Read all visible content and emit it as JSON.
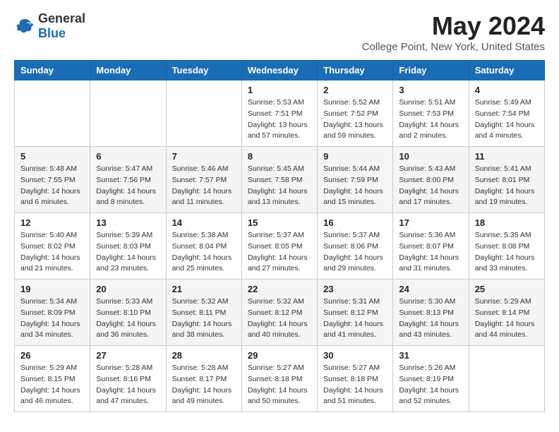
{
  "logo": {
    "general": "General",
    "blue": "Blue"
  },
  "header": {
    "month": "May 2024",
    "location": "College Point, New York, United States"
  },
  "weekdays": [
    "Sunday",
    "Monday",
    "Tuesday",
    "Wednesday",
    "Thursday",
    "Friday",
    "Saturday"
  ],
  "weeks": [
    [
      {
        "day": "",
        "info": ""
      },
      {
        "day": "",
        "info": ""
      },
      {
        "day": "",
        "info": ""
      },
      {
        "day": "1",
        "info": "Sunrise: 5:53 AM\nSunset: 7:51 PM\nDaylight: 13 hours\nand 57 minutes."
      },
      {
        "day": "2",
        "info": "Sunrise: 5:52 AM\nSunset: 7:52 PM\nDaylight: 13 hours\nand 59 minutes."
      },
      {
        "day": "3",
        "info": "Sunrise: 5:51 AM\nSunset: 7:53 PM\nDaylight: 14 hours\nand 2 minutes."
      },
      {
        "day": "4",
        "info": "Sunrise: 5:49 AM\nSunset: 7:54 PM\nDaylight: 14 hours\nand 4 minutes."
      }
    ],
    [
      {
        "day": "5",
        "info": "Sunrise: 5:48 AM\nSunset: 7:55 PM\nDaylight: 14 hours\nand 6 minutes."
      },
      {
        "day": "6",
        "info": "Sunrise: 5:47 AM\nSunset: 7:56 PM\nDaylight: 14 hours\nand 8 minutes."
      },
      {
        "day": "7",
        "info": "Sunrise: 5:46 AM\nSunset: 7:57 PM\nDaylight: 14 hours\nand 11 minutes."
      },
      {
        "day": "8",
        "info": "Sunrise: 5:45 AM\nSunset: 7:58 PM\nDaylight: 14 hours\nand 13 minutes."
      },
      {
        "day": "9",
        "info": "Sunrise: 5:44 AM\nSunset: 7:59 PM\nDaylight: 14 hours\nand 15 minutes."
      },
      {
        "day": "10",
        "info": "Sunrise: 5:43 AM\nSunset: 8:00 PM\nDaylight: 14 hours\nand 17 minutes."
      },
      {
        "day": "11",
        "info": "Sunrise: 5:41 AM\nSunset: 8:01 PM\nDaylight: 14 hours\nand 19 minutes."
      }
    ],
    [
      {
        "day": "12",
        "info": "Sunrise: 5:40 AM\nSunset: 8:02 PM\nDaylight: 14 hours\nand 21 minutes."
      },
      {
        "day": "13",
        "info": "Sunrise: 5:39 AM\nSunset: 8:03 PM\nDaylight: 14 hours\nand 23 minutes."
      },
      {
        "day": "14",
        "info": "Sunrise: 5:38 AM\nSunset: 8:04 PM\nDaylight: 14 hours\nand 25 minutes."
      },
      {
        "day": "15",
        "info": "Sunrise: 5:37 AM\nSunset: 8:05 PM\nDaylight: 14 hours\nand 27 minutes."
      },
      {
        "day": "16",
        "info": "Sunrise: 5:37 AM\nSunset: 8:06 PM\nDaylight: 14 hours\nand 29 minutes."
      },
      {
        "day": "17",
        "info": "Sunrise: 5:36 AM\nSunset: 8:07 PM\nDaylight: 14 hours\nand 31 minutes."
      },
      {
        "day": "18",
        "info": "Sunrise: 5:35 AM\nSunset: 8:08 PM\nDaylight: 14 hours\nand 33 minutes."
      }
    ],
    [
      {
        "day": "19",
        "info": "Sunrise: 5:34 AM\nSunset: 8:09 PM\nDaylight: 14 hours\nand 34 minutes."
      },
      {
        "day": "20",
        "info": "Sunrise: 5:33 AM\nSunset: 8:10 PM\nDaylight: 14 hours\nand 36 minutes."
      },
      {
        "day": "21",
        "info": "Sunrise: 5:32 AM\nSunset: 8:11 PM\nDaylight: 14 hours\nand 38 minutes."
      },
      {
        "day": "22",
        "info": "Sunrise: 5:32 AM\nSunset: 8:12 PM\nDaylight: 14 hours\nand 40 minutes."
      },
      {
        "day": "23",
        "info": "Sunrise: 5:31 AM\nSunset: 8:12 PM\nDaylight: 14 hours\nand 41 minutes."
      },
      {
        "day": "24",
        "info": "Sunrise: 5:30 AM\nSunset: 8:13 PM\nDaylight: 14 hours\nand 43 minutes."
      },
      {
        "day": "25",
        "info": "Sunrise: 5:29 AM\nSunset: 8:14 PM\nDaylight: 14 hours\nand 44 minutes."
      }
    ],
    [
      {
        "day": "26",
        "info": "Sunrise: 5:29 AM\nSunset: 8:15 PM\nDaylight: 14 hours\nand 46 minutes."
      },
      {
        "day": "27",
        "info": "Sunrise: 5:28 AM\nSunset: 8:16 PM\nDaylight: 14 hours\nand 47 minutes."
      },
      {
        "day": "28",
        "info": "Sunrise: 5:28 AM\nSunset: 8:17 PM\nDaylight: 14 hours\nand 49 minutes."
      },
      {
        "day": "29",
        "info": "Sunrise: 5:27 AM\nSunset: 8:18 PM\nDaylight: 14 hours\nand 50 minutes."
      },
      {
        "day": "30",
        "info": "Sunrise: 5:27 AM\nSunset: 8:18 PM\nDaylight: 14 hours\nand 51 minutes."
      },
      {
        "day": "31",
        "info": "Sunrise: 5:26 AM\nSunset: 8:19 PM\nDaylight: 14 hours\nand 52 minutes."
      },
      {
        "day": "",
        "info": ""
      }
    ]
  ]
}
